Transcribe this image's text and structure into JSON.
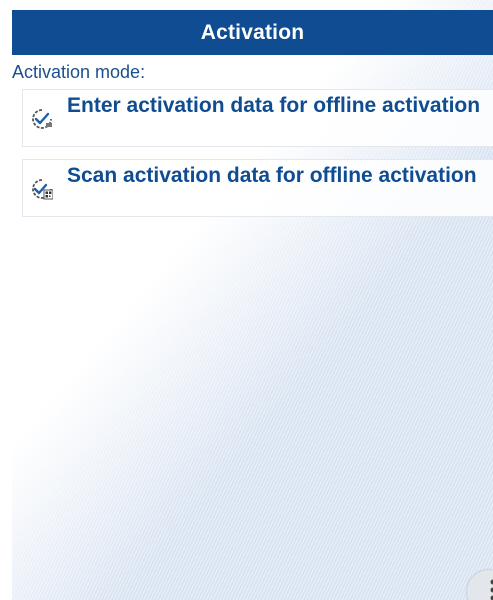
{
  "header": {
    "title": "Activation"
  },
  "mode_label": "Activation mode:",
  "options": [
    {
      "label": "Enter activation data for offline activation",
      "icon": "keyboard-check-icon"
    },
    {
      "label": "Scan activation data for offline activation",
      "icon": "qr-scan-check-icon"
    }
  ],
  "menu": {
    "icon": "more-vertical-icon"
  },
  "colors": {
    "accent": "#0f4c92",
    "label": "#1b4f8d"
  }
}
